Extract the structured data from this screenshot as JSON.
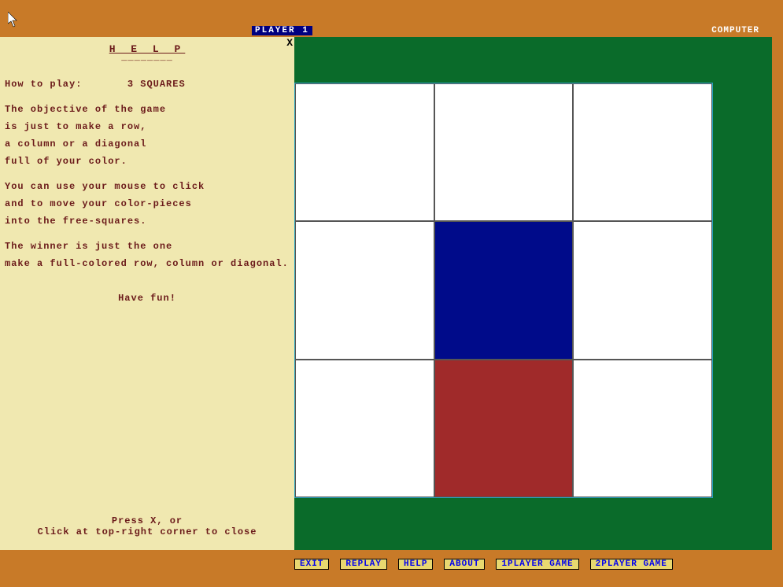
{
  "top": {
    "player_indicator": "PLAYER 1",
    "computer_label": "COMPUTER"
  },
  "help": {
    "close": "X",
    "title": "H E L P",
    "underline": "________",
    "howto_label": "How to play:",
    "game_name": "3 SQUARES",
    "lines": [
      "The objective of the game",
      "is just to make a row,",
      "a column or a diagonal",
      "full of your color.",
      "You can use your mouse to click",
      "and to move your color-pieces",
      "into the free-squares.",
      "The winner is just the one",
      "make a full-colored row, column or diagonal."
    ],
    "fun": "Have fun!",
    "footer1": "Press X, or",
    "footer2": "Click at top-right corner to close"
  },
  "board": {
    "cells": [
      "empty",
      "empty",
      "empty",
      "empty",
      "blue",
      "empty",
      "empty",
      "red",
      "empty"
    ]
  },
  "buttons": {
    "exit": "EXIT",
    "replay": "REPLAY",
    "help": "HELP",
    "about": "ABOUT",
    "one_player": "1PLAYER GAME",
    "two_player": "2PLAYER GAME"
  }
}
